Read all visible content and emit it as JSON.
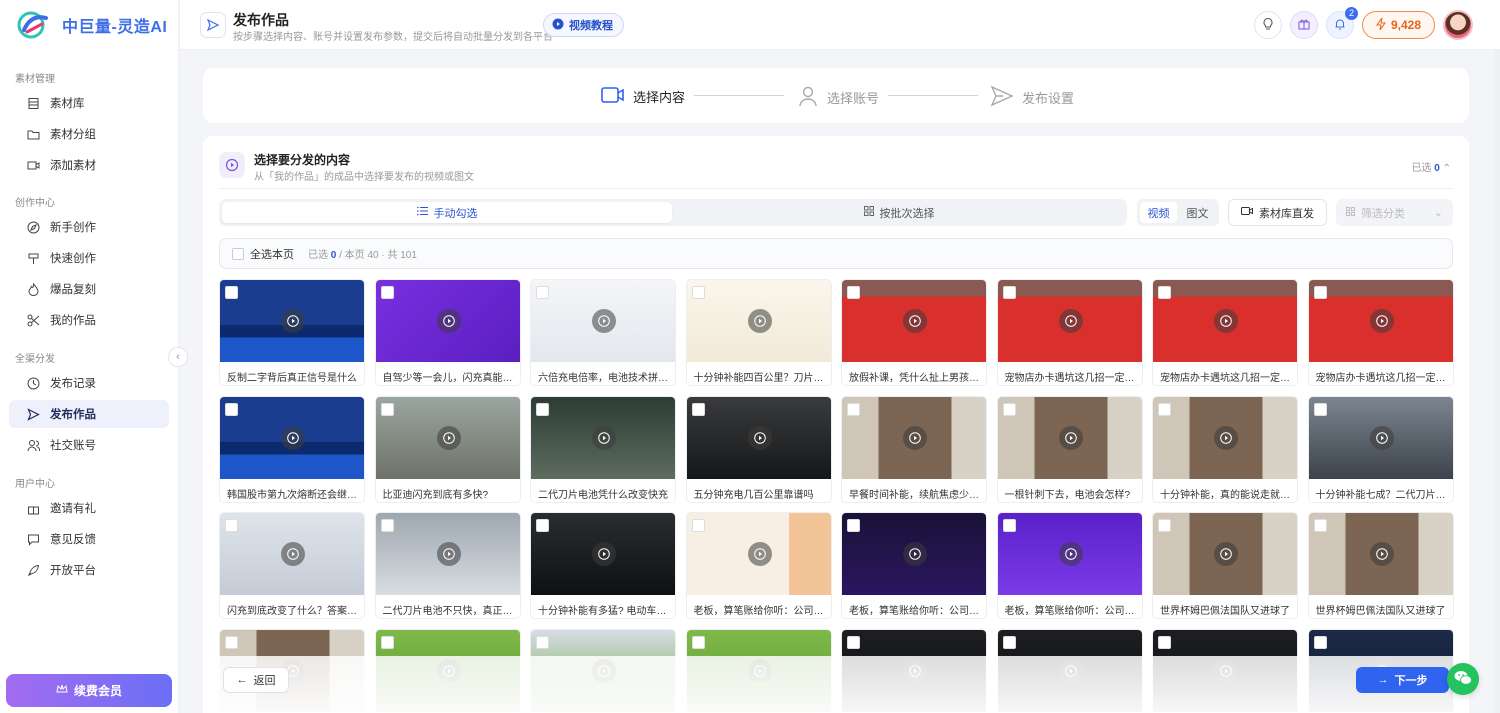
{
  "brand": {
    "name": "中巨量-灵造AI"
  },
  "sidebar": {
    "groups": [
      {
        "title": "素材管理",
        "items": [
          {
            "label": "素材库",
            "icon": "library-icon"
          },
          {
            "label": "素材分组",
            "icon": "folder-icon"
          },
          {
            "label": "添加素材",
            "icon": "add-media-icon"
          }
        ]
      },
      {
        "title": "创作中心",
        "items": [
          {
            "label": "新手创作",
            "icon": "compass-icon"
          },
          {
            "label": "快速创作",
            "icon": "brush-icon"
          },
          {
            "label": "爆品复刻",
            "icon": "flame-icon"
          },
          {
            "label": "我的作品",
            "icon": "scissors-icon"
          }
        ]
      },
      {
        "title": "全渠分发",
        "items": [
          {
            "label": "发布记录",
            "icon": "clock-icon"
          },
          {
            "label": "发布作品",
            "icon": "send-icon",
            "active": true
          },
          {
            "label": "社交账号",
            "icon": "users-icon"
          }
        ]
      },
      {
        "title": "用户中心",
        "items": [
          {
            "label": "邀请有礼",
            "icon": "gift-icon"
          },
          {
            "label": "意见反馈",
            "icon": "chat-icon"
          },
          {
            "label": "开放平台",
            "icon": "rocket-icon"
          }
        ]
      }
    ],
    "vip_button": "续费会员"
  },
  "header": {
    "title": "发布作品",
    "subtitle": "按步骤选择内容、账号并设置发布参数，提交后将自动批量分发到各平台",
    "tutorial": "视频教程",
    "notifications": "2",
    "points": "9,428"
  },
  "steps": [
    {
      "label": "选择内容",
      "icon": "video-icon",
      "active": true
    },
    {
      "label": "选择账号",
      "icon": "user-icon",
      "active": false
    },
    {
      "label": "发布设置",
      "icon": "send-icon",
      "active": false
    }
  ],
  "content": {
    "title": "选择要分发的内容",
    "subtitle": "从「我的作品」的成品中选择要发布的视频或图文",
    "selected_prefix": "已选",
    "selected_count": "0",
    "mode_manual": "手动勾选",
    "mode_batch": "按批次选择",
    "type_video": "视频",
    "type_image": "图文",
    "library_publish": "素材库直发",
    "filter_placeholder": "筛选分类",
    "select_all": "全选本页",
    "count_prefix": "已选",
    "count_selected": "0",
    "count_suffix": "/ 本页 40 · 共 101"
  },
  "tiles": [
    {
      "title": "反制二字背后真正信号是什么",
      "theme": "news"
    },
    {
      "title": "自驾少等一会儿，闪充真能改...",
      "theme": "purple"
    },
    {
      "title": "六倍充电倍率，电池技术拼什么",
      "theme": "white"
    },
    {
      "title": "十分钟补能四百公里？刀片电...",
      "theme": "cream"
    },
    {
      "title": "放假补课，凭什么扯上男孩子？",
      "theme": "red"
    },
    {
      "title": "宠物店办卡遇坑这几招一定要...",
      "theme": "red"
    },
    {
      "title": "宠物店办卡遇坑这几招一定要...",
      "theme": "red"
    },
    {
      "title": "宠物店办卡遇坑这几招一定要...",
      "theme": "red"
    },
    {
      "title": "韩国股市第九次熔断还会继续...",
      "theme": "news"
    },
    {
      "title": "比亚迪闪充到底有多快?",
      "theme": "car"
    },
    {
      "title": "二代刀片电池凭什么改变快充",
      "theme": "road"
    },
    {
      "title": "五分钟充电几百公里靠谱吗",
      "theme": "dark"
    },
    {
      "title": "早餐时间补能，续航焦虑少一半",
      "theme": "woman"
    },
    {
      "title": "一根针刺下去，电池会怎样?",
      "theme": "woman"
    },
    {
      "title": "十分钟补能，真的能说走就走?",
      "theme": "woman"
    },
    {
      "title": "十分钟补能七成？二代刀片电...",
      "theme": "grey"
    },
    {
      "title": "闪充到底改变了什么？答案不...",
      "theme": "snow"
    },
    {
      "title": "二代刀片电池不只快，真正狠...",
      "theme": "snow2"
    },
    {
      "title": "十分钟补能有多猛? 电动车充...",
      "theme": "darkcar"
    },
    {
      "title": "老板，算笔账给你听：公司养...",
      "theme": "cream2"
    },
    {
      "title": "老板，算笔账给你听：公司养...",
      "theme": "purple2"
    },
    {
      "title": "老板，算笔账给你听：公司养...",
      "theme": "purple3"
    },
    {
      "title": "世界杯姆巴佩法国队又进球了",
      "theme": "woman"
    },
    {
      "title": "世界杯姆巴佩法国队又进球了",
      "theme": "woman"
    },
    {
      "title": "",
      "theme": "woman"
    },
    {
      "title": "",
      "theme": "field"
    },
    {
      "title": "",
      "theme": "field2"
    },
    {
      "title": "",
      "theme": "field"
    },
    {
      "title": "",
      "theme": "black"
    },
    {
      "title": "",
      "theme": "black"
    },
    {
      "title": "",
      "theme": "black"
    },
    {
      "title": "",
      "theme": "navy"
    }
  ],
  "bottom": {
    "back": "返回",
    "next": "下一步"
  },
  "colors": {
    "accent": "#2f63f0",
    "points": "#e8631a",
    "vip": "#8a6ef2"
  }
}
